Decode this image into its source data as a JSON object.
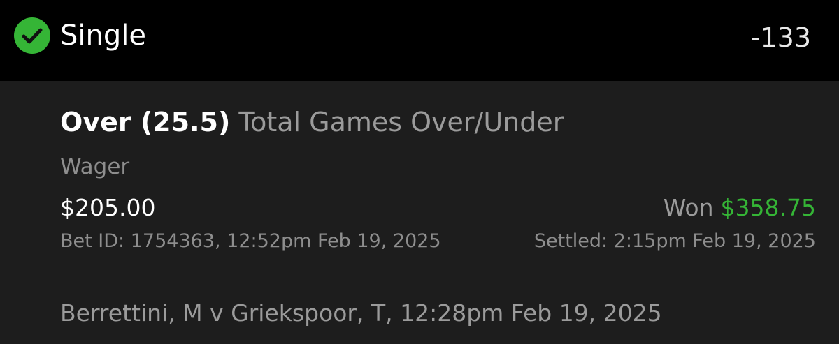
{
  "header": {
    "status_icon": "check-circle-icon",
    "bet_type": "Single",
    "odds": "-133"
  },
  "bet": {
    "selection": "Over (25.5)",
    "market": "Total Games Over/Under",
    "wager_label": "Wager",
    "wager_amount": "$205.00",
    "result_label": "Won",
    "result_amount": "$358.75",
    "bet_id_line": "Bet ID: 1754363, 12:52pm Feb 19, 2025",
    "settled_line": "Settled: 2:15pm Feb 19, 2025",
    "event_line": "Berrettini, M v Griekspoor, T, 12:28pm Feb 19, 2025"
  },
  "colors": {
    "header_bg": "#000000",
    "card_bg": "#1d1d1d",
    "accent_green": "#35b536",
    "primary_text": "#ffffff",
    "secondary_text": "#9b9b9b"
  }
}
